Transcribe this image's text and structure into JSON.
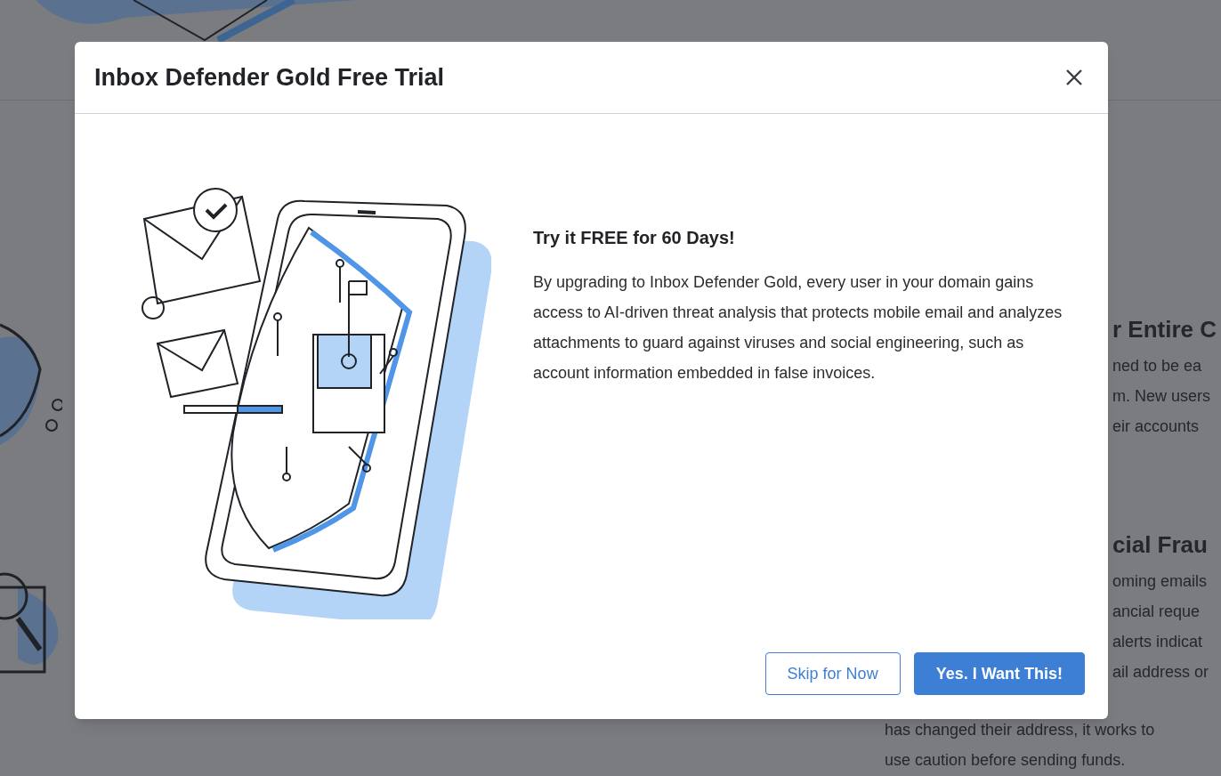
{
  "background": {
    "sections": [
      {
        "heading": "r Entire C",
        "lines": [
          "ned to be ea",
          "m. New users",
          "eir accounts"
        ]
      },
      {
        "heading": "cial Frau",
        "lines": [
          "oming emails",
          "ancial reque",
          "alerts indicat",
          "ail address or"
        ]
      }
    ],
    "trailing_lines": [
      "has changed their address, it works to",
      "use caution before sending funds."
    ]
  },
  "dialog": {
    "title": "Inbox Defender Gold Free Trial",
    "heading": "Try it FREE for 60 Days!",
    "body": "By upgrading to Inbox Defender Gold, every user in your domain gains access to AI-driven threat analysis that protects mobile email and analyzes attachments to guard against viruses and social engineering, such as account information embedded in false invoices.",
    "buttons": [
      {
        "label": "Skip for Now",
        "kind": "secondary"
      },
      {
        "label": "Yes. I Want This!",
        "kind": "primary"
      }
    ]
  }
}
